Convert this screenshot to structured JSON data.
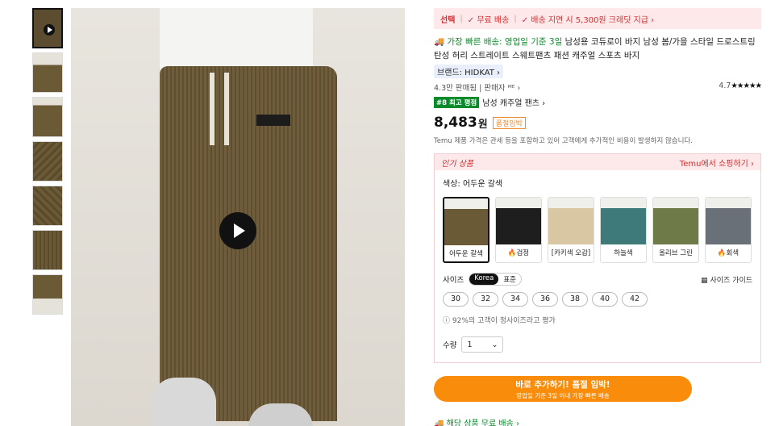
{
  "promo": {
    "select_label": "선택",
    "free_shipping": "✓ 무료 배송",
    "delay_credit": "✓ 배송 지연 시 5,300원 크레딧 지급 ›"
  },
  "product": {
    "fast_prefix": "🚚 가장 빠른 배송: 영업일 기준 3일",
    "title": " 남성용 코듀로이 바지 남성 봄/가을 스타일 드로스트링 탄성 허리 스트레이트 스웨트팬츠 패션 캐주얼 스포츠 바지",
    "brand": "브랜드: HIDKAT ›",
    "sold": "4.3만 판매됨 | 판매자 ᴹᴱ ›",
    "rating": "4.7",
    "stars": "★★★★★",
    "rank_badge": "#8 최고 평점",
    "rank_text": "남성 캐주얼 팬츠 ›",
    "price": "8,483",
    "price_unit": "원",
    "soon_badge": "품절임박",
    "notice": "Temu 제품 가격은 관세 등을 포함하고 있어 고객에게 추가적인 비용이 발생하지 않습니다."
  },
  "popular": {
    "title": "인기 상품",
    "shop_link": "Temu에서 쇼핑하기 ›",
    "color_label": "색상: 어두운 갈색",
    "swatches": [
      {
        "label": "어두운 갈색",
        "color": "#6b5a36"
      },
      {
        "label": "🔥검정",
        "color": "#1e1e1e"
      },
      {
        "label": "[카키색 오감]",
        "color": "#d9c7a3"
      },
      {
        "label": "하늘색",
        "color": "#3f7a7a"
      },
      {
        "label": "올리브 그린",
        "color": "#6e7a48"
      },
      {
        "label": "🔥회색",
        "color": "#6a7078"
      }
    ],
    "size_label": "사이즈",
    "toggle_on": "Korea",
    "toggle_off": "표준",
    "size_guide": "▦ 사이즈 가이드",
    "sizes": [
      "30",
      "32",
      "34",
      "36",
      "38",
      "40",
      "42"
    ],
    "fit_note": "ⓘ 92%의 고객이 정사이즈라고 평가",
    "qty_label": "수량",
    "qty_value": "1"
  },
  "cta": {
    "line1": "바로 추가하기! 품절 임박!",
    "line2": "영업일 기준 3일 이내 가장 빠른 배송"
  },
  "shipping": "🚚 해당 상품 무료 배송 ›"
}
